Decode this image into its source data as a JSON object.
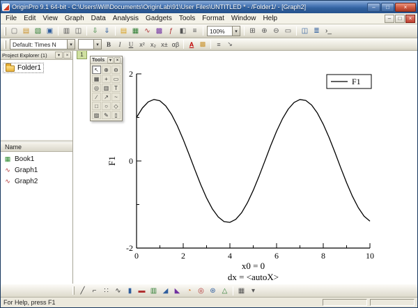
{
  "window": {
    "title": "OriginPro 9.1 64-bit - C:\\Users\\Will\\Documents\\OriginLab\\91\\User Files\\UNTITLED * - /Folder1/ - [Graph2]",
    "buttons": [
      {
        "name": "minimize",
        "glyph": "–"
      },
      {
        "name": "maximize",
        "glyph": "□"
      },
      {
        "name": "close",
        "glyph": "×",
        "cls": "close"
      }
    ]
  },
  "menu": {
    "items": [
      "File",
      "Edit",
      "View",
      "Graph",
      "Data",
      "Analysis",
      "Gadgets",
      "Tools",
      "Format",
      "Window",
      "Help"
    ],
    "child_buttons": [
      {
        "name": "child-minimize",
        "glyph": "–"
      },
      {
        "name": "child-restore",
        "glyph": "□"
      },
      {
        "name": "child-close",
        "glyph": "×",
        "cls": "close-red"
      }
    ]
  },
  "toolbar_standard": {
    "zoom": "100%",
    "icons_a": [
      {
        "name": "new-project",
        "glyph": "▢",
        "color": "#6a6a6a"
      },
      {
        "name": "open",
        "glyph": "▤",
        "color": "#c9912a"
      },
      {
        "name": "open-excel",
        "glyph": "▧",
        "color": "#2e7d32"
      },
      {
        "name": "save-project",
        "glyph": "▣",
        "color": "#2f5e9e"
      },
      {
        "sep": true
      },
      {
        "name": "print",
        "glyph": "▥",
        "color": "#555555"
      },
      {
        "name": "print-preview",
        "glyph": "◫",
        "color": "#555555"
      },
      {
        "sep": true
      },
      {
        "name": "import-wizard",
        "glyph": "⇩",
        "color": "#2e7d32"
      },
      {
        "name": "import-single-ascii",
        "glyph": "⇓",
        "color": "#2f5e9e"
      },
      {
        "sep": true
      },
      {
        "name": "new-folder",
        "glyph": "▤",
        "color": "#d8a020"
      },
      {
        "name": "new-workbook",
        "glyph": "▦",
        "color": "#2e7d32"
      },
      {
        "name": "new-graph",
        "glyph": "∿",
        "color": "#b03030"
      },
      {
        "name": "new-matrix",
        "glyph": "▩",
        "color": "#7030a0"
      },
      {
        "name": "new-function-plot",
        "glyph": "ƒ",
        "color": "#b03030"
      },
      {
        "name": "new-layout",
        "glyph": "◧",
        "color": "#555555"
      },
      {
        "name": "new-notes",
        "glyph": "≡",
        "color": "#555555"
      },
      {
        "sep": true
      }
    ],
    "icons_b": [
      {
        "sep": true
      },
      {
        "name": "rescale",
        "glyph": "⊞",
        "color": "#555555"
      },
      {
        "name": "zoom-in",
        "glyph": "⊕",
        "color": "#555555"
      },
      {
        "name": "zoom-out",
        "glyph": "⊖",
        "color": "#555555"
      },
      {
        "name": "whole-page",
        "glyph": "▭",
        "color": "#555555"
      },
      {
        "sep": true
      },
      {
        "name": "project-explorer-toggle",
        "glyph": "◫",
        "color": "#2f5e9e"
      },
      {
        "name": "results-log",
        "glyph": "≣",
        "color": "#2f5e9e"
      },
      {
        "name": "command-window",
        "glyph": "›_",
        "color": "#333333"
      }
    ]
  },
  "format_toolbar": {
    "font": "Default: Times N",
    "size": "",
    "icons": [
      {
        "name": "bold",
        "glyph": "B",
        "cls": "b"
      },
      {
        "name": "italic",
        "glyph": "I",
        "cls": "i"
      },
      {
        "name": "underline",
        "glyph": "U",
        "cls": "u"
      },
      {
        "name": "superscript",
        "glyph": "x²"
      },
      {
        "name": "subscript",
        "glyph": "x₂"
      },
      {
        "name": "super-subscript",
        "glyph": "x±"
      },
      {
        "name": "greek",
        "glyph": "αβ"
      },
      {
        "sep": true
      },
      {
        "name": "font-color",
        "glyph": "A",
        "cls": "fc"
      },
      {
        "name": "fill-color",
        "glyph": "▩",
        "color": "#c9912a"
      },
      {
        "sep": true
      },
      {
        "name": "align-left",
        "glyph": "≡",
        "color": "#555555"
      },
      {
        "name": "arrow-annotation",
        "glyph": "↘",
        "color": "#555555"
      }
    ]
  },
  "project_explorer": {
    "title": "Project Explorer (1)",
    "header_buttons": [
      {
        "name": "pe-menu",
        "glyph": "▾"
      },
      {
        "name": "pe-close",
        "glyph": "×"
      }
    ],
    "folder": {
      "label": "Folder1"
    },
    "columns": {
      "name": "Name"
    },
    "items": [
      {
        "label": "Book1",
        "icon": "workbook",
        "glyph": "▦",
        "color": "#2e8b2e"
      },
      {
        "label": "Graph1",
        "icon": "graph",
        "glyph": "∿",
        "color": "#b03030"
      },
      {
        "label": "Graph2",
        "icon": "graph",
        "glyph": "∿",
        "color": "#b03030"
      }
    ]
  },
  "graph_window": {
    "tab": "1"
  },
  "tools_palette": {
    "title": "Tools",
    "buttons": [
      {
        "name": "tools-menu",
        "glyph": "▾"
      },
      {
        "name": "tools-close",
        "glyph": "×"
      }
    ],
    "tools": [
      {
        "name": "pointer",
        "glyph": "↖",
        "selected": true
      },
      {
        "name": "zoom-in-tool",
        "glyph": "⊕"
      },
      {
        "name": "zoom-out-tool",
        "glyph": "⊖"
      },
      {
        "name": "mask-range",
        "glyph": "▦"
      },
      {
        "name": "move-data",
        "glyph": "+"
      },
      {
        "name": "scale-in",
        "glyph": "▭"
      },
      {
        "name": "screen-reader",
        "glyph": "◎"
      },
      {
        "name": "data-reader",
        "glyph": "▥"
      },
      {
        "name": "text-tool",
        "glyph": "T"
      },
      {
        "name": "line-tool",
        "glyph": "∕"
      },
      {
        "name": "arrow-tool",
        "glyph": "↗"
      },
      {
        "name": "curve-tool",
        "glyph": "~"
      },
      {
        "name": "rectangle-tool",
        "glyph": "□"
      },
      {
        "name": "circle-tool",
        "glyph": "○"
      },
      {
        "name": "polygon-tool",
        "glyph": "◇"
      },
      {
        "name": "region-tool",
        "glyph": "▨"
      },
      {
        "name": "freehand-tool",
        "glyph": "✎"
      },
      {
        "name": "eraser-tool",
        "glyph": "▯"
      }
    ]
  },
  "graphs_toolbar": {
    "icons": [
      {
        "name": "line-plot",
        "glyph": "╱",
        "color": "#333333"
      },
      {
        "name": "horizontal-step-plot",
        "glyph": "⌐",
        "color": "#333333"
      },
      {
        "name": "scatter-plot",
        "glyph": "∷",
        "color": "#333333"
      },
      {
        "name": "line-symbol-plot",
        "glyph": "∿",
        "color": "#333333"
      },
      {
        "name": "column-plot",
        "glyph": "▮",
        "color": "#2f5e9e"
      },
      {
        "name": "bar-plot",
        "glyph": "▬",
        "color": "#b03030"
      },
      {
        "name": "stacked-column-plot",
        "glyph": "▥",
        "color": "#2e7d32"
      },
      {
        "name": "area-plot",
        "glyph": "◢",
        "color": "#2f5e9e"
      },
      {
        "name": "fill-area-plot",
        "glyph": "◣",
        "color": "#7030a0"
      },
      {
        "name": "pie-chart",
        "glyph": "◔",
        "color": "#d07020"
      },
      {
        "name": "doughnut-chart",
        "glyph": "◎",
        "color": "#b03030"
      },
      {
        "name": "polar-plot",
        "glyph": "⊛",
        "color": "#2f5e9e"
      },
      {
        "name": "ternary-plot",
        "glyph": "△",
        "color": "#2e7d32"
      },
      {
        "sep": true
      },
      {
        "name": "template-library",
        "glyph": "▦",
        "color": "#555555"
      },
      {
        "name": "more-plot-types",
        "glyph": "▾",
        "color": "#555555"
      }
    ]
  },
  "status_bar": {
    "text": "For Help, press F1"
  },
  "chart_data": {
    "type": "line",
    "title": "",
    "ylabel": "F1",
    "xlabel_lines": [
      "x0 = 0",
      "dx = <autoX>"
    ],
    "legend": [
      "F1"
    ],
    "legend_position": "top-right",
    "grid": false,
    "xlim": [
      0,
      10
    ],
    "ylim": [
      -2,
      2
    ],
    "xticks": [
      0,
      2,
      4,
      6,
      8,
      10
    ],
    "xticks_minor": [
      1,
      3,
      5,
      7,
      9
    ],
    "yticks": [
      2,
      0,
      -2
    ],
    "yticks_minor": [
      1,
      -1
    ],
    "series": [
      {
        "name": "F1",
        "x": [
          0,
          0.25,
          0.5,
          0.75,
          1,
          1.25,
          1.5,
          1.75,
          2,
          2.25,
          2.5,
          2.75,
          3,
          3.25,
          3.5,
          3.75,
          4,
          4.25,
          4.5,
          4.75,
          5,
          5.25,
          5.5,
          5.75,
          6,
          6.25,
          6.5,
          6.75,
          7,
          7.25,
          7.5,
          7.75,
          8,
          8.25,
          8.5,
          8.75,
          9,
          9.25,
          9.5,
          9.75,
          10
        ],
        "y": [
          1.0,
          1.216,
          1.357,
          1.413,
          1.382,
          1.264,
          1.068,
          0.806,
          0.493,
          0.15,
          -0.203,
          -0.543,
          -0.849,
          -1.102,
          -1.287,
          -1.392,
          -1.41,
          -1.341,
          -1.188,
          -0.962,
          -0.675,
          -0.347,
          0.003,
          0.353,
          0.681,
          0.966,
          1.192,
          1.343,
          1.411,
          1.391,
          1.285,
          1.099,
          0.844,
          0.537,
          0.197,
          -0.156,
          -0.499,
          -0.811,
          -1.072,
          -1.267,
          -1.383
        ]
      }
    ]
  }
}
